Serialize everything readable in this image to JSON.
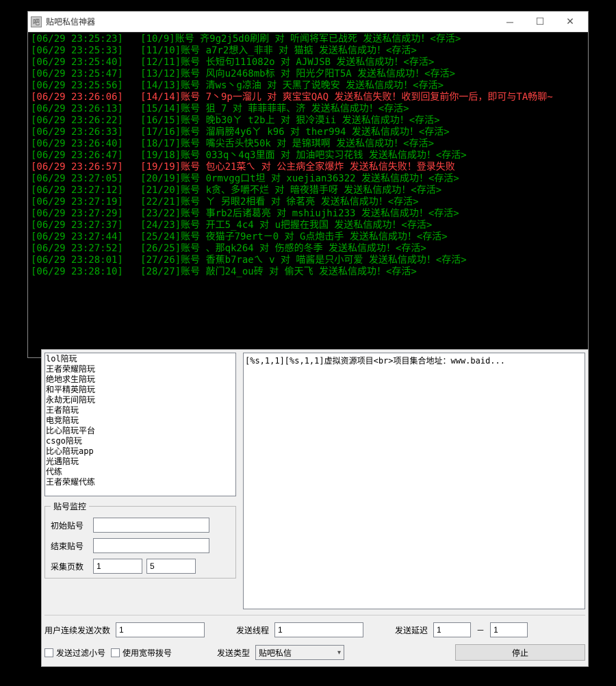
{
  "window": {
    "title": "贴吧私信神器"
  },
  "console_lines": [
    {
      "c": "g",
      "t": "[06/29 23:25:23]   [10/9]账号 齐9g2j5d0刷刷 对 听闻将军已战死 发送私信成功！<存活>"
    },
    {
      "c": "g",
      "t": "[06/29 23:25:33]   [11/10]账号 a7r2想入_非非 对 猫掂 发送私信成功！<存活>"
    },
    {
      "c": "g",
      "t": "[06/29 23:25:40]   [12/11]账号 长短句111082o 对 AJWJSB 发送私信成功！<存活>"
    },
    {
      "c": "g",
      "t": "[06/29 23:25:47]   [13/12]账号 风向u2468mb标 对 阳光夕阳T5A 发送私信成功！<存活>"
    },
    {
      "c": "g",
      "t": "[06/29 23:25:56]   [14/13]账号 清ws丶g凉油 对 天黑了说晚安 发送私信成功！<存活>"
    },
    {
      "c": "r",
      "t": "[06/29 23:26:06]   [14/14]账号 7丶9p一溜儿 对 爽宝宝QAQ 发送私信失败！收到回复前你一后，即可与TA畅聊~"
    },
    {
      "c": "g",
      "t": "[06/29 23:26:13]   [15/14]账号 狙_7 对 菲菲菲菲、济 发送私信成功！<存活>"
    },
    {
      "c": "g",
      "t": "[06/29 23:26:22]   [16/15]账号 晚b30ㄚ t2b上 对 狠冷漠ii 发送私信成功！<存活>"
    },
    {
      "c": "g",
      "t": "[06/29 23:26:33]   [17/16]账号 溜肩膀4y6ㄚ k96 对 ther994 发送私信成功！<存活>"
    },
    {
      "c": "g",
      "t": "[06/29 23:26:40]   [18/17]账号 嘴尖舌头快50k 对 是锦琪啊 发送私信成功！<存活>"
    },
    {
      "c": "g",
      "t": "[06/29 23:26:47]   [19/18]账号 033q丶4q3里面 对 加油吧实习花钱 发送私信成功！<存活>"
    },
    {
      "c": "r",
      "t": "[06/29 23:26:57]   [19/19]账号 包心21菜ㄟ 对 公主病全家爆炸 发送私信失败！登录失败"
    },
    {
      "c": "g",
      "t": "[06/29 23:27:05]   [20/19]账号 0rmvgg口t坦 对 xuejian36322 发送私信成功！<存活>"
    },
    {
      "c": "g",
      "t": "[06/29 23:27:12]   [21/20]账号 k贪、多嚼不烂 对 暗夜猎手呀 发送私信成功！<存活>"
    },
    {
      "c": "g",
      "t": "[06/29 23:27:19]   [22/21]账号 ㄚ 另眼2相看 对 徐茗亮 发送私信成功！<存活>"
    },
    {
      "c": "g",
      "t": "[06/29 23:27:29]   [23/22]账号 事rb2后诸葛亮 对 mshiujhi233 发送私信成功！<存活>"
    },
    {
      "c": "g",
      "t": "[06/29 23:27:37]   [24/23]账号 开工5_4c4 对 u把握在我国 发送私信成功！<存活>"
    },
    {
      "c": "g",
      "t": "[06/29 23:27:44]   [25/24]账号 夜猫子79ertㄧ0 对 G点炮击手 发送私信成功！<存活>"
    },
    {
      "c": "g",
      "t": "[06/29 23:27:52]   [26/25]账号 、那qk264 对 伤感的冬季 发送私信成功！<存活>"
    },
    {
      "c": "g",
      "t": "[06/29 23:28:01]   [27/26]账号 香蕉b7raeㄟ v 对 喵酱是只小可爱 发送私信成功！<存活>"
    },
    {
      "c": "g",
      "t": "[06/29 23:28:10]   [28/27]账号 敲门24_ou砖 对 偷天飞 发送私信成功！<存活>"
    }
  ],
  "list_items": [
    "lol陪玩",
    "王者荣耀陪玩",
    "绝地求生陪玩",
    "和平精英陪玩",
    "永劫无间陪玩",
    "王者陪玩",
    "电竞陪玩",
    "比心陪玩平台",
    "csgo陪玩",
    "比心陪玩app",
    "光遇陪玩",
    "代练",
    "王者荣耀代练"
  ],
  "message_template": "[%s,1,1][%s,1,1]虚拟资源项目<br>项目集合地址：www.baid...",
  "monitor": {
    "legend": "贴号监控",
    "start_label": "初始贴号",
    "start_val": "",
    "end_label": "结束贴号",
    "end_val": "",
    "pages_label": "采集页数",
    "pages_from": "1",
    "pages_to": "5"
  },
  "bottom": {
    "send_count_label": "用户连续发送次数",
    "send_count": "1",
    "threads_label": "发送线程",
    "threads": "1",
    "delay_label": "发送延迟",
    "delay_from": "1",
    "delay_to": "1",
    "filter_label": "发送过滤小号",
    "dial_label": "使用宽带拨号",
    "type_label": "发送类型",
    "type_value": "贴吧私信",
    "stop_label": "停止"
  }
}
